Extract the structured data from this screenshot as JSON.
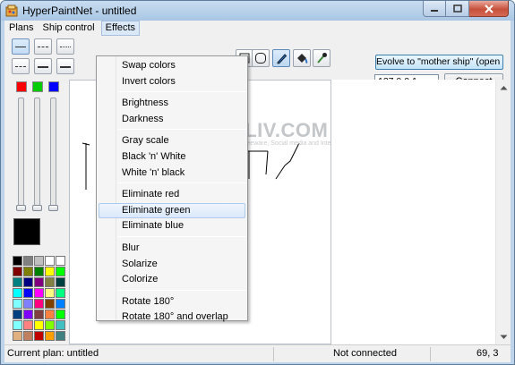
{
  "window": {
    "title": "HyperPaintNet - untitled"
  },
  "menu": {
    "items": [
      "Plans",
      "Ship control",
      "Effects"
    ],
    "open": "Effects"
  },
  "effects_menu": {
    "groups": [
      [
        "Swap colors",
        "Invert colors"
      ],
      [
        "Brightness",
        "Darkness"
      ],
      [
        "Gray scale",
        "Black 'n' White",
        "White 'n' black"
      ],
      [
        "Eliminate red",
        "Eliminate green",
        "Eliminate blue"
      ],
      [
        "Blur",
        "Solarize",
        "Colorize"
      ],
      [
        "Rotate 180°",
        "Rotate 180° and overlap"
      ]
    ],
    "highlighted": "Eliminate green"
  },
  "network": {
    "evolve_label": "Evolve to \"mother ship\" (open server)",
    "ip_value": "127.0.0.1",
    "connect_label": "Connect"
  },
  "colors": {
    "rgb_swatches": [
      "#ff0000",
      "#00cc00",
      "#0000ff"
    ],
    "current": "#000000",
    "palette": [
      "#000000",
      "#808080",
      "#c0c0c0",
      "#ffffff",
      "#ffffff",
      "#800000",
      "#808000",
      "#008000",
      "#ffff00",
      "#00ff00",
      "#008080",
      "#000080",
      "#800080",
      "#808040",
      "#004040",
      "#00ffff",
      "#0000ff",
      "#ff00ff",
      "#ffff80",
      "#00ff80",
      "#80ffff",
      "#8080ff",
      "#ff0080",
      "#804000",
      "#0080ff",
      "#004080",
      "#8000ff",
      "#804040",
      "#ff8040",
      "#00ff00",
      "#80ffff",
      "#ff8080",
      "#ffff00",
      "#80ff00",
      "#40c0c0",
      "#e0b080",
      "#c08060",
      "#c00000",
      "#ffa000",
      "#408080"
    ]
  },
  "watermark": {
    "main": "IRMALIV.COM",
    "sub": "Tech tips, Windows, Freeware, Social media and Internet"
  },
  "status": {
    "plan": "Current plan: untitled",
    "connection": "Not connected",
    "coords": "69, 3"
  }
}
